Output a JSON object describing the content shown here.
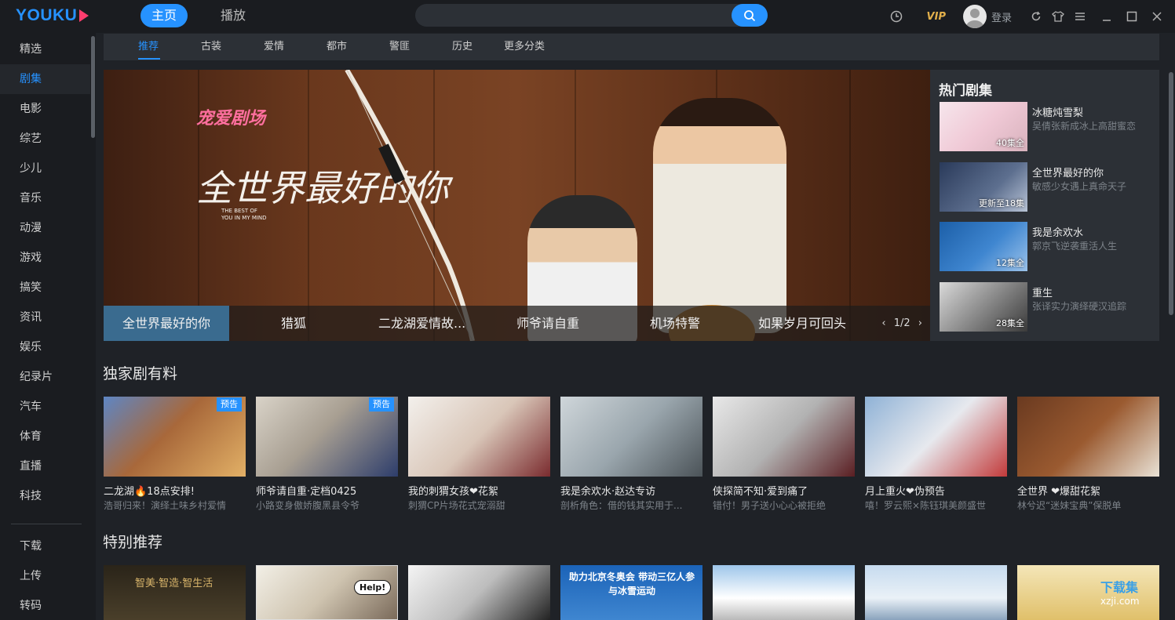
{
  "app": {
    "logo_text": "YOUKU",
    "nav": {
      "home": "主页",
      "play": "播放"
    },
    "search": {
      "placeholder": ""
    },
    "vip_label": "VIP",
    "login_label": "登录",
    "accent_color": "#2692ff"
  },
  "sidebar": {
    "items": [
      "精选",
      "剧集",
      "电影",
      "综艺",
      "少儿",
      "音乐",
      "动漫",
      "游戏",
      "搞笑",
      "资讯",
      "娱乐",
      "纪录片",
      "汽车",
      "体育",
      "直播",
      "科技"
    ],
    "active_index": 1,
    "bottom_items": [
      "下载",
      "上传",
      "转码"
    ]
  },
  "categories": {
    "items": [
      "推荐",
      "古装",
      "爱情",
      "都市",
      "警匪",
      "历史",
      "更多分类"
    ],
    "active_index": 0
  },
  "banner": {
    "brand": "宠爱剧场",
    "title": "全世界最好的你",
    "subtitle": "THE BEST OF YOU IN MY MIND",
    "tabs": [
      "全世界最好的你",
      "猎狐",
      "二龙湖爱情故...",
      "师爷请自重",
      "机场特警",
      "如果岁月可回头"
    ],
    "active_tab": 0,
    "pager": "1/2",
    "prev_icon": "chevron-left-icon",
    "next_icon": "chevron-right-icon"
  },
  "hot": {
    "title": "热门剧集",
    "items": [
      {
        "name": "冰糖炖雪梨",
        "desc": "吴倩张新成冰上高甜蜜恋",
        "episodes": "40集全"
      },
      {
        "name": "全世界最好的你",
        "desc": "敏感少女遇上真命天子",
        "episodes": "更新至18集"
      },
      {
        "name": "我是余欢水",
        "desc": "郭京飞逆袭重活人生",
        "episodes": "12集全"
      },
      {
        "name": "重生",
        "desc": "张译实力演绎硬汉追踪",
        "episodes": "28集全"
      }
    ]
  },
  "exclusive": {
    "title": "独家剧有料",
    "items": [
      {
        "title": "二龙湖🔥18点安排!",
        "desc": "浩哥归来！演绎土味乡村爱情",
        "badge": "预告"
      },
      {
        "title": "师爷请自重·定档0425",
        "desc": "小路变身傲娇腹黑县令爷",
        "badge": "预告"
      },
      {
        "title": "我的刺猬女孩❤花絮",
        "desc": "刺猬CP片场花式宠溺甜",
        "badge": ""
      },
      {
        "title": "我是余欢水·赵达专访",
        "desc": "剖析角色：借的钱其实用于...",
        "badge": ""
      },
      {
        "title": "侠探简不知·爱到痛了",
        "desc": "错付！男子送小心心被拒绝",
        "badge": ""
      },
      {
        "title": "月上重火❤伪预告",
        "desc": "嘻！罗云熙×陈钰琪美颜盛世",
        "badge": ""
      },
      {
        "title": "全世界 ❤爆甜花絮",
        "desc": "林兮迟“迷妹宝典”保脱单",
        "badge": ""
      }
    ]
  },
  "special": {
    "title": "特别推荐",
    "items": [
      "智美·智造·智生活",
      "Help!",
      "",
      "助力北京冬奥会 带动三亿人参与冰雪运动",
      "",
      "",
      ""
    ]
  },
  "watermark": {
    "line1": "下载集",
    "line2": "xzji.com"
  }
}
